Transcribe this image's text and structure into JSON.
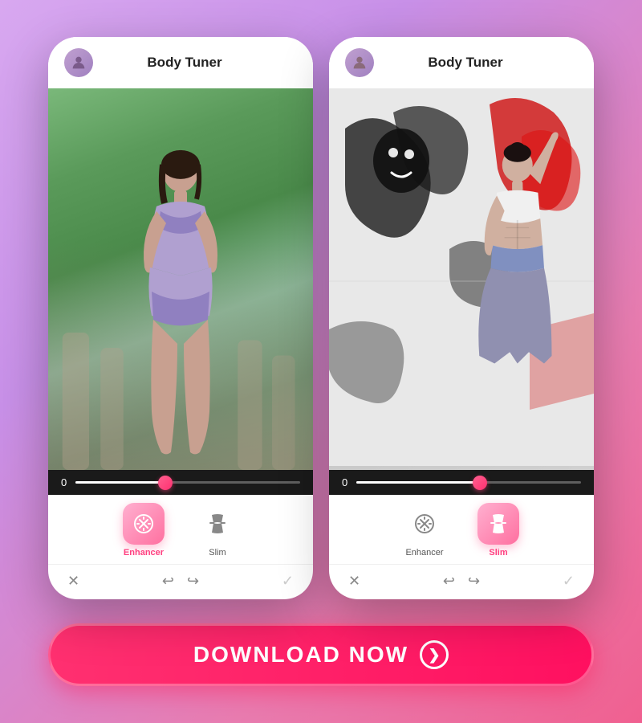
{
  "app": {
    "title": "Body Tuner",
    "background": "linear-gradient(135deg, #d8a8f0, #e870b0)"
  },
  "phone1": {
    "title": "Body Tuner",
    "slider_value": "0",
    "tools": [
      {
        "id": "enhancer",
        "label": "Enhancer",
        "active": true
      },
      {
        "id": "slim",
        "label": "Slim",
        "active": false
      }
    ],
    "bottom_actions": [
      "×",
      "↩",
      "↪",
      "✓"
    ]
  },
  "phone2": {
    "title": "Body Tuner",
    "slider_value": "0",
    "tools": [
      {
        "id": "enhancer",
        "label": "Enhancer",
        "active": false
      },
      {
        "id": "slim",
        "label": "Slim",
        "active": true
      }
    ],
    "bottom_actions": [
      "×",
      "↩",
      "↪",
      "✓"
    ]
  },
  "download_button": {
    "label": "DOWNLOAD NOW",
    "arrow": "❯"
  }
}
